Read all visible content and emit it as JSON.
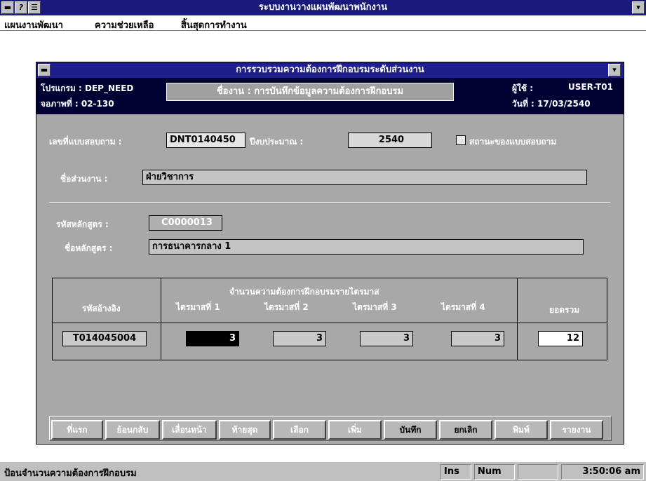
{
  "app": {
    "title": "ระบบงานวางแผนพัฒนาพนักงาน",
    "menu": [
      "แผนงานพัฒนา",
      "ความช่วยเหลือ",
      "สิ้นสุดการทำงาน"
    ]
  },
  "form": {
    "title": "การรวบรวมความต้องการฝึกอบรมระดับส่วนงาน",
    "program_label": "โปรแกรม : DEP_NEED",
    "screen_label": "จอภาพที่ : 02-130",
    "screen_title": "ชื่องาน : การบันทึกข้อมูลความต้องการฝึกอบรม",
    "user_label": "ผู้ใช้ :",
    "user_value": "USER-T01",
    "date_label": "วันที่ : 17/03/2540",
    "qno_label": "เลขที่แบบสอบถาม :",
    "qno_value": "DNT0140450",
    "year_label": "ปีงบประมาณ :",
    "year_value": "2540",
    "status_label": "สถานะของแบบสอบถาม",
    "dept_label": "ชื่อส่วนงาน :",
    "dept_value": "ฝ่ายวิชาการ",
    "course_code_label": "รหัสหลักสูตร :",
    "course_code_value": "C0000013",
    "course_name_label": "ชื่อหลักสูตร :",
    "course_name_value": "การธนาคารกลาง 1"
  },
  "table": {
    "col_ref": "รหัสอ้างอิง",
    "group_header": "จำนวนความต้องการฝึกอบรมรายไตรมาส",
    "quarters": [
      "ไตรมาสที่ 1",
      "ไตรมาสที่ 2",
      "ไตรมาสที่ 3",
      "ไตรมาสที่ 4"
    ],
    "col_total": "ยอดรวม",
    "row": {
      "ref": "T014045004",
      "q1": "3",
      "q2": "3",
      "q3": "3",
      "q4": "3",
      "total": "12"
    }
  },
  "buttons": [
    "ที่แรก",
    "ย้อนกลับ",
    "เลื่อนหน้า",
    "ท้ายสุด",
    "เลือก",
    "เพิ่ม",
    "บันทึก",
    "ยกเลิก",
    "พิมพ์",
    "รายงาน"
  ],
  "status": {
    "message": "ป้อนจำนวนความต้องการฝึกอบรม",
    "ins": "Ins",
    "num": "Num",
    "time": "3:50:06 am"
  }
}
